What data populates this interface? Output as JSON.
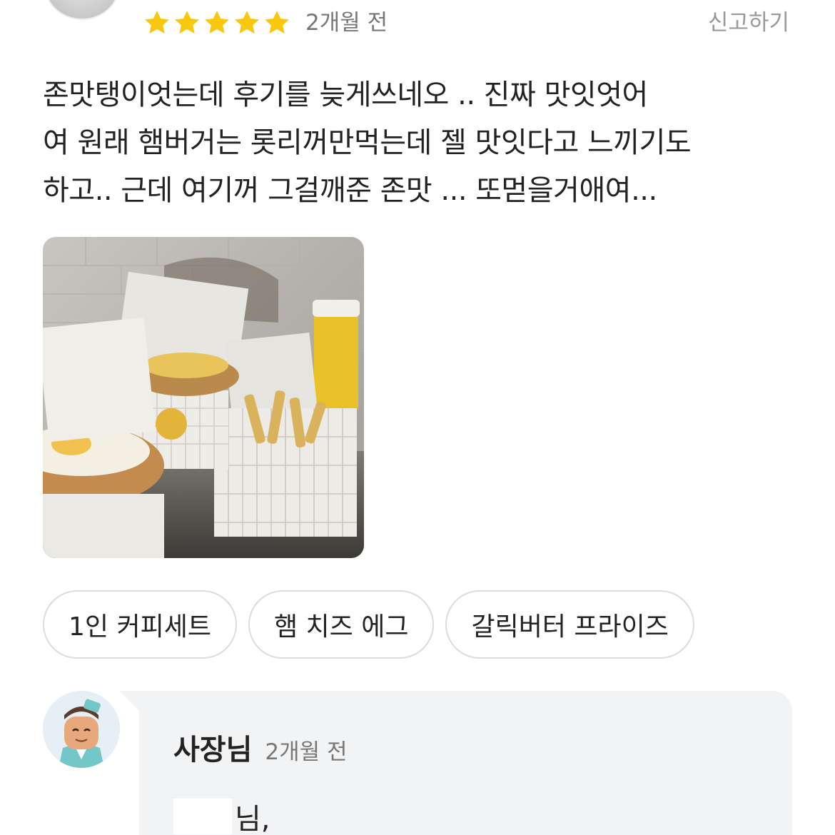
{
  "review": {
    "rating": 5,
    "rating_max": 5,
    "date": "2개월 전",
    "report_label": "신고하기",
    "text_lines": [
      "존맛탱이엇는데 후기를 늦게쓰네오 .. 진짜 맛잇엇어",
      "여 원래 햄버거는 롯리꺼만먹는데 젤 맛잇다고 느끼기도",
      "하고.. 근데 여기꺼 그걸깨준 존맛 ... 또먿을거애여..."
    ],
    "menu_tags": [
      "1인 커피세트",
      "햄 치즈 에그",
      "갈릭버터 프라이즈"
    ]
  },
  "colors": {
    "star": "#f9c80e",
    "reply_bg": "#f2f3f5",
    "chip_border": "#dcdcdc"
  },
  "reply": {
    "author": "사장님",
    "date": "2개월 전",
    "greeting_suffix": "님,"
  },
  "icons": {
    "star": "star-icon",
    "reviewer_avatar": "reviewer-avatar",
    "owner_avatar": "owner-avatar"
  }
}
